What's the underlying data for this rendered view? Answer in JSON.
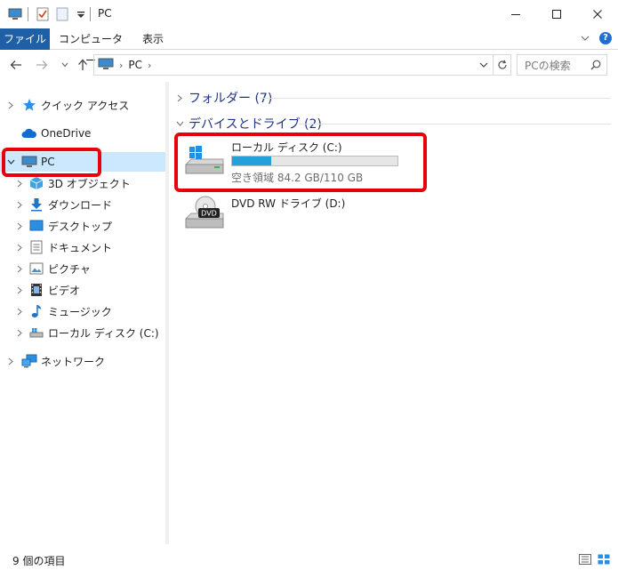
{
  "window": {
    "title": "PC"
  },
  "ribbon": {
    "tabs": [
      {
        "label": "ファイル"
      },
      {
        "label": "コンピューター"
      },
      {
        "label": "表示"
      }
    ]
  },
  "address": {
    "crumb": "PC",
    "search_placeholder": "PCの検索"
  },
  "nav": {
    "items": [
      {
        "label": "クイック アクセス",
        "icon": "star-icon"
      },
      {
        "label": "OneDrive",
        "icon": "cloud-icon"
      },
      {
        "label": "PC",
        "icon": "computer-icon"
      },
      {
        "label": "3D オブジェクト",
        "icon": "cube-icon"
      },
      {
        "label": "ダウンロード",
        "icon": "download-icon"
      },
      {
        "label": "デスクトップ",
        "icon": "desktop-icon"
      },
      {
        "label": "ドキュメント",
        "icon": "document-icon"
      },
      {
        "label": "ピクチャ",
        "icon": "picture-icon"
      },
      {
        "label": "ビデオ",
        "icon": "video-icon"
      },
      {
        "label": "ミュージック",
        "icon": "music-icon"
      },
      {
        "label": "ローカル ディスク (C:)",
        "icon": "drive-icon"
      },
      {
        "label": "ネットワーク",
        "icon": "network-icon"
      }
    ]
  },
  "content": {
    "folders_header": "フォルダー (7)",
    "devices_header": "デバイスとドライブ (2)",
    "drives": [
      {
        "name": "ローカル ディスク (C:)",
        "free": "空き領域 84.2 GB/110 GB",
        "used_fraction": 0.235
      },
      {
        "name": "DVD RW ドライブ (D:)"
      }
    ]
  },
  "status": {
    "count": "9 個の項目"
  },
  "colors": {
    "accent": "#1f5fa5",
    "selection": "#cce8ff",
    "highlight": "#e8000a",
    "usage_bar": "#26a0da",
    "group_header": "#1e3287"
  }
}
